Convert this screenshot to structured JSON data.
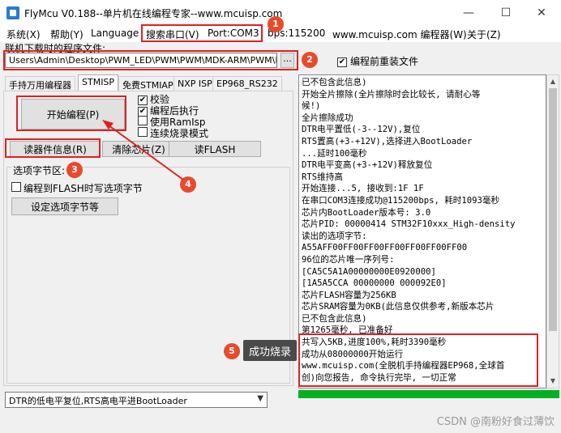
{
  "window": {
    "title": "FlyMcu V0.188--单片机在线编程专家--www.mcuisp.com",
    "minimize": "—",
    "maximize": "☐",
    "close": "✕"
  },
  "menu": [
    {
      "label": "系统(X)"
    },
    {
      "label": "帮助(Y)"
    },
    {
      "label": "Language"
    },
    {
      "label": "搜索串口(V)"
    },
    {
      "label": "Port:COM3"
    },
    {
      "label": "bps:115200"
    },
    {
      "label": "www.mcuisp.com 编程器(W)"
    },
    {
      "label": "关于(Z)"
    }
  ],
  "file": {
    "label": "联机下载时的程序文件:",
    "path": "Users\\Admin\\Desktop\\PWM_LED\\PWM\\PWM\\MDK-ARM\\PWM\\PWM.hex",
    "browse": "...",
    "reload_label": "编程前重装文件",
    "reload_checked": true
  },
  "tabs": [
    {
      "label": "手持万用编程器"
    },
    {
      "label": "STMISP"
    },
    {
      "label": "免费STMIAP"
    },
    {
      "label": "NXP ISP"
    },
    {
      "label": "EP968_RS232"
    }
  ],
  "stmisp": {
    "start_button": "开始编程(P)",
    "verify": "校验",
    "run_after": "编程后执行",
    "use_ramisp": "使用RamIsp",
    "continuous": "连续烧录模式",
    "read_info": "读器件信息(R)",
    "clear_chip": "清除芯片(Z)",
    "read_flash": "读FLASH",
    "option_group": "选项字节区:",
    "write_option": "编程到FLASH时写选项字节",
    "set_option": "设定选项字节等"
  },
  "reset_mode": "DTR的低电平复位,RTS高电平进BootLoader",
  "log": [
    "已不包含此信息)",
    "开始全片擦除(全片擦除时会比较长, 请耐心等",
    "候!)",
    "全片擦除成功",
    "DTR电平置低(-3--12V),复位",
    "RTS置高(+3-+12V),选择进入BootLoader",
    "...延时100毫秒",
    "DTR电平变高(+3-+12V)释放复位",
    "RTS维持高",
    "开始连接...5, 接收到:1F 1F",
    "在串口COM3连接成功@115200bps, 耗时1093毫秒",
    "芯片内BootLoader版本号: 3.0",
    "芯片PID: 00000414  STM32F10xxx_High-density",
    "读出的选项字节:",
    "A55AFF00FF00FF00FF00FF00FF00FF00",
    "96位的芯片唯一序列号:",
    "[CA5C5A1A00000000E0920000]",
    "[1A5A5CCA 00000000 000092E0]",
    "芯片FLASH容量为256KB",
    "芯片SRAM容量为0KB(此信息仅供参考,新版本芯片",
    "已不包含此信息)",
    "第1265毫秒, 已准备好",
    "共写入5KB,进度100%,耗时3390毫秒",
    "成功从08000000开始运行",
    "www.mcuisp.com(全脱机手持编程器EP968,全球首",
    "创)向您报告, 命令执行完毕, 一切正常"
  ],
  "annotations": {
    "badges": [
      "1",
      "2",
      "3",
      "4",
      "5"
    ],
    "tooltip": "成功烧录",
    "watermark": "CSDN @南粉好食过薄饮"
  },
  "colors": {
    "highlight": "#e02020",
    "badge": "#e84b2b",
    "progress": "#06b025"
  }
}
